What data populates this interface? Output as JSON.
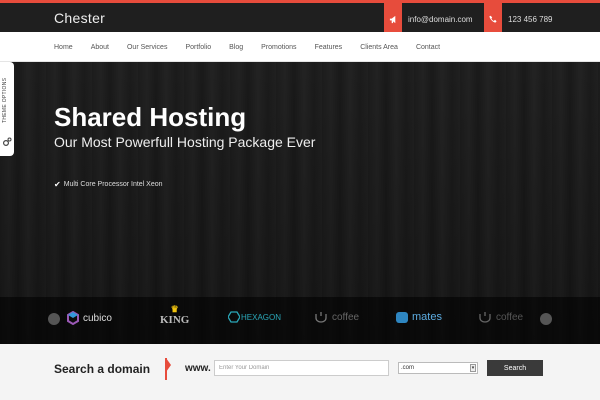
{
  "header": {
    "brand": "Chester",
    "email": "info@domain.com",
    "phone": "123 456 789",
    "accent_color": "#e74c3c"
  },
  "nav": {
    "items": [
      "Home",
      "About",
      "Our Services",
      "Portfolio",
      "Blog",
      "Promotions",
      "Features",
      "Clients Area",
      "Contact"
    ]
  },
  "theme_options": {
    "label": "THEME OPTIONS"
  },
  "hero": {
    "title": "Shared Hosting",
    "subtitle": "Our Most Powerfull Hosting Package Ever",
    "features": [
      "Multi Core Processor Intel Xeon"
    ]
  },
  "partners": {
    "logos": [
      "cubico",
      "KING",
      "HEXAGON",
      "coffee",
      "mates",
      "coffee"
    ]
  },
  "domain_search": {
    "title": "Search a domain",
    "prefix": "www.",
    "placeholder": "Enter Your Domain",
    "tld_selected": ".com",
    "button_label": "Search"
  }
}
